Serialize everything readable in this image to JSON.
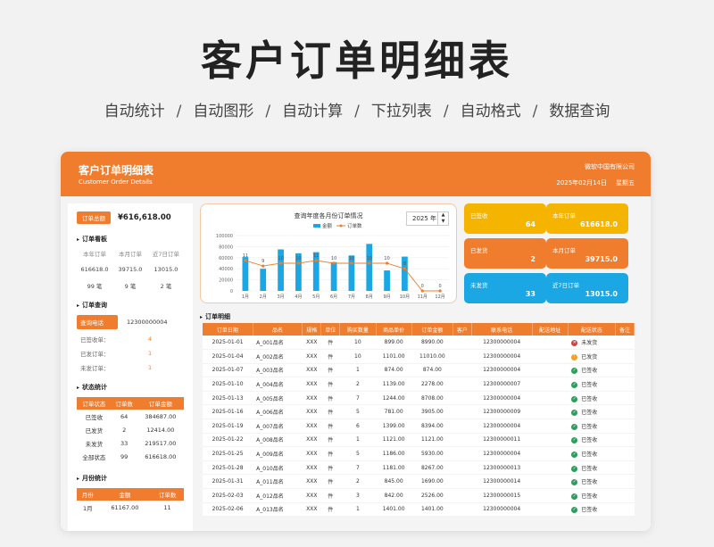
{
  "hero": {
    "title": "客户订单明细表",
    "tags": [
      "自动统计",
      "自动图形",
      "自动计算",
      "下拉列表",
      "自动格式",
      "数据查询"
    ],
    "separator": "/"
  },
  "banner": {
    "title": "客户订单明细表",
    "subtitle": "Customer Order Details",
    "company": "微软中国有限公司",
    "date": "2025年02月14日",
    "weekday": "星期五"
  },
  "colors": {
    "orange": "#ef7d2d",
    "yellow": "#f5b400",
    "blue": "#1aa7e4",
    "green": "#2e9c5c",
    "red": "#d64040",
    "amber": "#f0a028"
  },
  "left": {
    "total_label": "订单总额",
    "total_value": "¥616,618.00",
    "kanban": {
      "title": "订单看板",
      "headers": [
        "本年订单",
        "本月订单",
        "近7日订单"
      ],
      "amounts": [
        "616618.0",
        "39715.0",
        "13015.0"
      ],
      "counts": [
        "99 笔",
        "9 笔",
        "2 笔"
      ]
    },
    "query": {
      "title": "订单查询",
      "phone_label": "查询电话",
      "phone_value": "12300000004",
      "rows": [
        {
          "label": "已签收单：",
          "value": "4"
        },
        {
          "label": "已发订单：",
          "value": "1"
        },
        {
          "label": "未发订单：",
          "value": "1"
        }
      ]
    },
    "status": {
      "title": "状态统计",
      "headers": [
        "订单状态",
        "订单数",
        "订单金额"
      ],
      "rows": [
        [
          "已签收",
          "64",
          "384687.00"
        ],
        [
          "已发货",
          "2",
          "12414.00"
        ],
        [
          "未发货",
          "33",
          "219517.00"
        ],
        [
          "全部状态",
          "99",
          "616618.00"
        ]
      ]
    },
    "monthly": {
      "title": "月份统计",
      "headers": [
        "月份",
        "金额",
        "订单数"
      ],
      "rows": [
        [
          "1月",
          "61167.00",
          "11"
        ]
      ]
    }
  },
  "chart": {
    "title": "查询年度各月份订单情况",
    "year": "2025 年",
    "legend": [
      "金额",
      "订单数"
    ]
  },
  "chart_data": {
    "type": "bar",
    "title": "查询年度各月份订单情况",
    "categories": [
      "1月",
      "2月",
      "3月",
      "4月",
      "5月",
      "6月",
      "7月",
      "8月",
      "9月",
      "10月",
      "11月",
      "12月"
    ],
    "y_ticks": [
      "0",
      "20000",
      "40000",
      "60000",
      "80000",
      "100000"
    ],
    "ylim": [
      0,
      100000
    ],
    "series": [
      {
        "name": "金额",
        "type": "bar",
        "values": [
          61167,
          40000,
          75000,
          68000,
          70000,
          52000,
          64000,
          85000,
          37000,
          62000,
          0,
          0
        ]
      },
      {
        "name": "订单数",
        "type": "line",
        "values": [
          11,
          9,
          10,
          10,
          11,
          10,
          10,
          10,
          10,
          8,
          0,
          0
        ]
      }
    ],
    "legend": "top-center"
  },
  "cards": [
    {
      "label": "已签收",
      "value": "64",
      "color": "#f5b400"
    },
    {
      "label": "本年订单",
      "value": "616618.0",
      "color": "#f5b400"
    },
    {
      "label": "已发货",
      "value": "2",
      "color": "#ef7d2d"
    },
    {
      "label": "本月订单",
      "value": "39715.0",
      "color": "#ef7d2d"
    },
    {
      "label": "未发货",
      "value": "33",
      "color": "#1aa7e4"
    },
    {
      "label": "近7日订单",
      "value": "13015.0",
      "color": "#1aa7e4"
    }
  ],
  "orders": {
    "title": "订单明细",
    "headers": [
      "订单日期",
      "品名",
      "规格",
      "单位",
      "购买数量",
      "商品单价",
      "订单金额",
      "客户",
      "联系电话",
      "配送地址",
      "配送状态",
      "备注"
    ],
    "rows": [
      [
        "2025-01-01",
        "A_001品名",
        "XXX",
        "件",
        "10",
        "899.00",
        "8990.00",
        "",
        "12300000004",
        "",
        "未发货",
        ""
      ],
      [
        "2025-01-04",
        "A_002品名",
        "XXX",
        "件",
        "10",
        "1101.00",
        "11010.00",
        "",
        "12300000004",
        "",
        "已发货",
        ""
      ],
      [
        "2025-01-07",
        "A_003品名",
        "XXX",
        "件",
        "1",
        "874.00",
        "874.00",
        "",
        "12300000004",
        "",
        "已签收",
        ""
      ],
      [
        "2025-01-10",
        "A_004品名",
        "XXX",
        "件",
        "2",
        "1139.00",
        "2278.00",
        "",
        "12300000007",
        "",
        "已签收",
        ""
      ],
      [
        "2025-01-13",
        "A_005品名",
        "XXX",
        "件",
        "7",
        "1244.00",
        "8708.00",
        "",
        "12300000004",
        "",
        "已签收",
        ""
      ],
      [
        "2025-01-16",
        "A_006品名",
        "XXX",
        "件",
        "5",
        "781.00",
        "3905.00",
        "",
        "12300000009",
        "",
        "已签收",
        ""
      ],
      [
        "2025-01-19",
        "A_007品名",
        "XXX",
        "件",
        "6",
        "1399.00",
        "8394.00",
        "",
        "12300000004",
        "",
        "已签收",
        ""
      ],
      [
        "2025-01-22",
        "A_008品名",
        "XXX",
        "件",
        "1",
        "1121.00",
        "1121.00",
        "",
        "12300000011",
        "",
        "已签收",
        ""
      ],
      [
        "2025-01-25",
        "A_009品名",
        "XXX",
        "件",
        "5",
        "1186.00",
        "5930.00",
        "",
        "12300000004",
        "",
        "已签收",
        ""
      ],
      [
        "2025-01-28",
        "A_010品名",
        "XXX",
        "件",
        "7",
        "1181.00",
        "8267.00",
        "",
        "12300000013",
        "",
        "已签收",
        ""
      ],
      [
        "2025-01-31",
        "A_011品名",
        "XXX",
        "件",
        "2",
        "845.00",
        "1690.00",
        "",
        "12300000014",
        "",
        "已签收",
        ""
      ],
      [
        "2025-02-03",
        "A_012品名",
        "XXX",
        "件",
        "3",
        "842.00",
        "2526.00",
        "",
        "12300000015",
        "",
        "已签收",
        ""
      ],
      [
        "2025-02-06",
        "A_013品名",
        "XXX",
        "件",
        "1",
        "1401.00",
        "1401.00",
        "",
        "12300000004",
        "",
        "已签收",
        ""
      ]
    ]
  }
}
